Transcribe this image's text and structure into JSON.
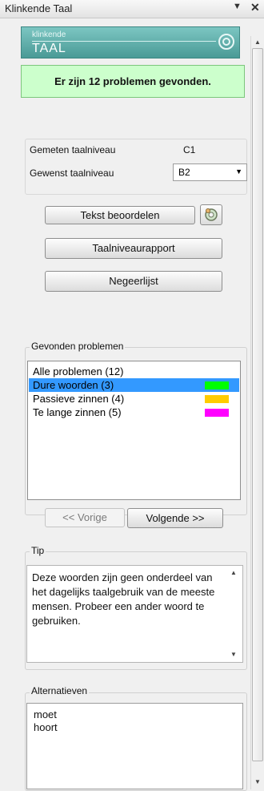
{
  "window": {
    "title": "Klinkende Taal",
    "pin_icon": "▼",
    "close_icon": "✕"
  },
  "logo": {
    "small": "klinkende",
    "big": "TAAL"
  },
  "status": {
    "text": "Er zijn 12 problemen gevonden.",
    "color": "#ccffcc"
  },
  "levels": {
    "measured_label": "Gemeten taalniveau",
    "measured_value": "C1",
    "desired_label": "Gewenst taalniveau",
    "desired_value": "B2"
  },
  "buttons": {
    "assess": "Tekst beoordelen",
    "report": "Taalniveaurapport",
    "ignore": "Negeerlijst",
    "prev": "<< Vorige",
    "next": "Volgende >>"
  },
  "problems": {
    "label": "Gevonden problemen",
    "items": [
      {
        "label": "Alle problemen (12)",
        "color": ""
      },
      {
        "label": "Dure woorden (3)",
        "color": "#00ff00"
      },
      {
        "label": "Passieve zinnen (4)",
        "color": "#ffcc00"
      },
      {
        "label": "Te lange zinnen (5)",
        "color": "#ff00ff"
      }
    ],
    "selected_index": 1
  },
  "tip": {
    "label": "Tip",
    "text": "Deze woorden zijn geen onderdeel van het dagelijks taalgebruik van de meeste mensen. Probeer een ander woord te gebruiken."
  },
  "alternatives": {
    "label": "Alternatieven",
    "items": [
      "moet",
      "hoort"
    ]
  }
}
